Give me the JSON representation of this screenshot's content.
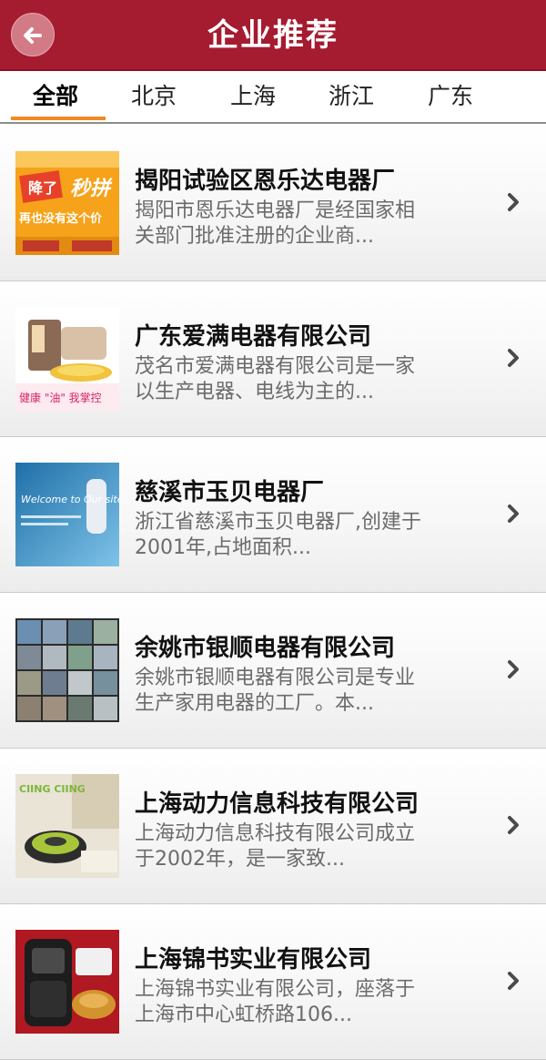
{
  "header": {
    "title": "企业推荐",
    "back_icon": "back-arrow-icon"
  },
  "tabs": [
    {
      "label": "全部",
      "active": true
    },
    {
      "label": "北京",
      "active": false
    },
    {
      "label": "上海",
      "active": false
    },
    {
      "label": "浙江",
      "active": false
    },
    {
      "label": "广东",
      "active": false
    }
  ],
  "companies": [
    {
      "name": "揭阳试验区恩乐达电器厂",
      "desc_line1": "揭阳市恩乐达电器厂是经国家相",
      "desc_line2": "关部门批准注册的企业商...",
      "thumb_text_1": "降了",
      "thumb_text_2": "再也没有这个价",
      "thumb_text_3": "秒拼"
    },
    {
      "name": "广东爱满电器有限公司",
      "desc_line1": "茂名市爱满电器有限公司是一家",
      "desc_line2": "以生产电器、电线为主的...",
      "thumb_text_1": "健康 \"油\" 我掌控"
    },
    {
      "name": "慈溪市玉贝电器厂",
      "desc_line1": "浙江省慈溪市玉贝电器厂,创建于",
      "desc_line2": "2001年,占地面积...",
      "thumb_text_1": "Welcome to Our site!"
    },
    {
      "name": "余姚市银顺电器有限公司",
      "desc_line1": "余姚市银顺电器有限公司是专业",
      "desc_line2": "生产家用电器的工厂。本..."
    },
    {
      "name": "上海动力信息科技有限公司",
      "desc_line1": "上海动力信息科技有限公司成立",
      "desc_line2": "于2002年，是一家致...",
      "thumb_text_1": "CIING CIING"
    },
    {
      "name": "上海锦书实业有限公司",
      "desc_line1": "上海锦书实业有限公司，座落于",
      "desc_line2": "上海市中心虹桥路106..."
    }
  ],
  "colors": {
    "header_bg": "#a51b30",
    "tab_indicator": "#f08a24"
  }
}
